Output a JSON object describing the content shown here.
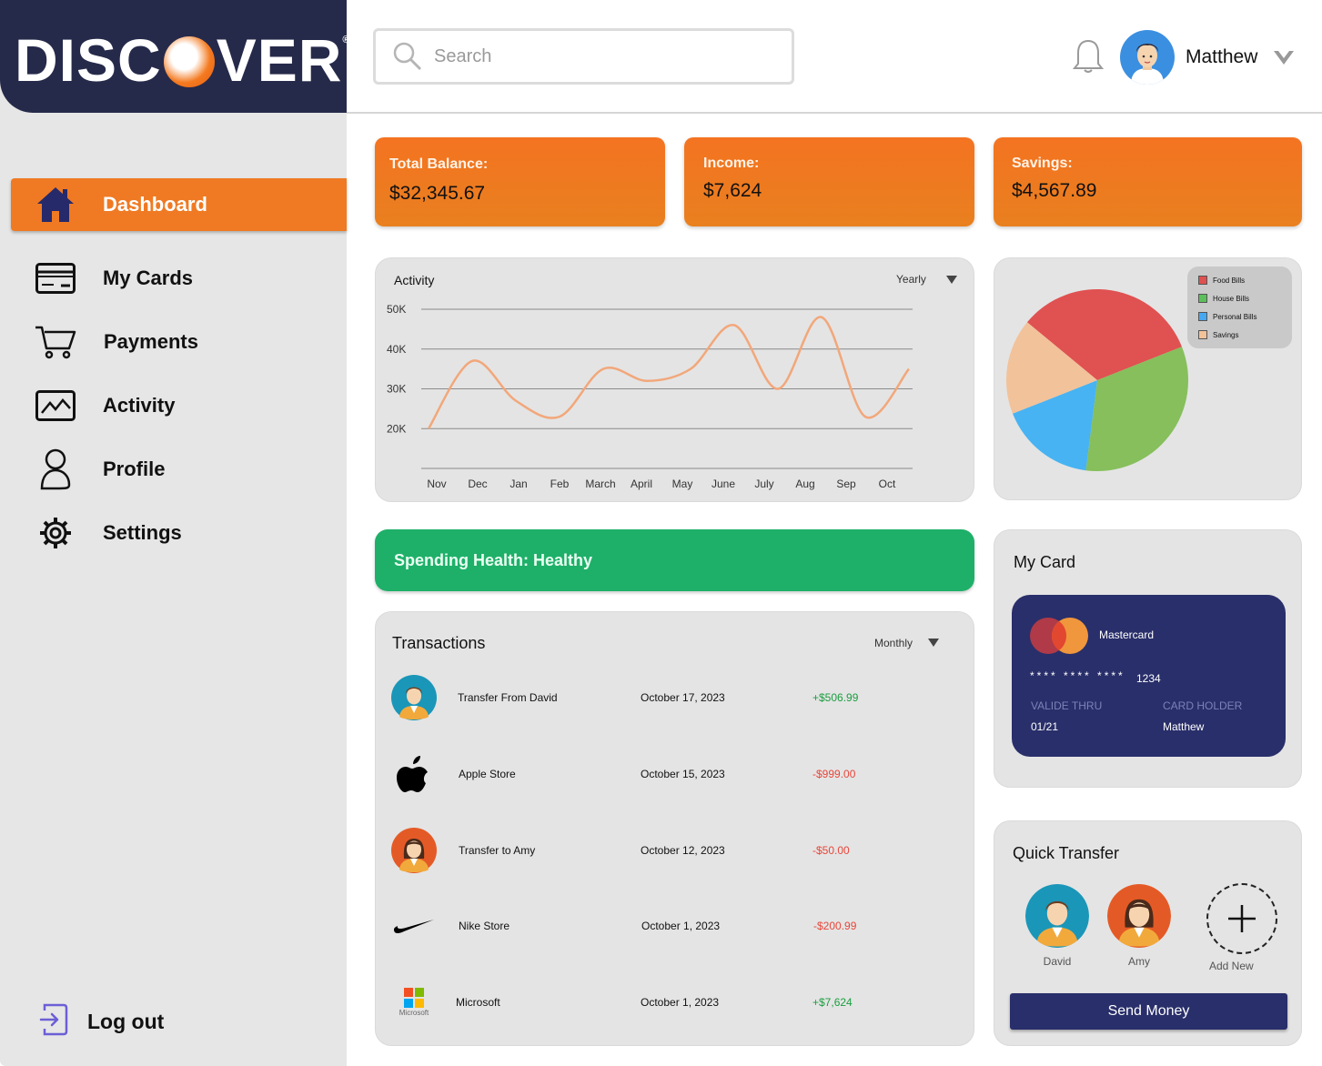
{
  "brand": {
    "logo_text_before": "DISC",
    "logo_text_after": "VER",
    "logo_mark": "®"
  },
  "sidebar": {
    "items": [
      {
        "label": "Dashboard",
        "icon": "home-icon",
        "active": true
      },
      {
        "label": "My Cards",
        "icon": "card-icon"
      },
      {
        "label": "Payments",
        "icon": "cart-icon"
      },
      {
        "label": "Activity",
        "icon": "activity-icon"
      },
      {
        "label": "Profile",
        "icon": "profile-icon"
      },
      {
        "label": "Settings",
        "icon": "gear-icon"
      }
    ],
    "logout_label": "Log out"
  },
  "header": {
    "search_placeholder": "Search",
    "user_name": "Matthew"
  },
  "stats": [
    {
      "label": "Total Balance:",
      "value": "$32,345.67"
    },
    {
      "label": "Income:",
      "value": "$7,624"
    },
    {
      "label": "Savings:",
      "value": "$4,567.89"
    }
  ],
  "activity": {
    "title": "Activity",
    "period": "Yearly"
  },
  "chart_data": [
    {
      "type": "line",
      "title": "Activity",
      "x": [
        "Nov",
        "Dec",
        "Jan",
        "Feb",
        "March",
        "April",
        "May",
        "June",
        "July",
        "Aug",
        "Sep",
        "Oct"
      ],
      "y_ticks": [
        "50K",
        "40K",
        "30K",
        "20K"
      ],
      "ylim": [
        10000,
        50000
      ],
      "series": [
        {
          "values": [
            20000,
            37000,
            27000,
            23000,
            35000,
            32000,
            35000,
            46000,
            30000,
            48000,
            23000,
            35000
          ],
          "color": "#f2a77a"
        }
      ],
      "grid": true
    },
    {
      "type": "pie",
      "legend": [
        "Food Bills",
        "House Bills",
        "Personal Bills",
        "Savings"
      ],
      "legend_position": "top-right",
      "values": [
        33,
        33,
        17,
        17
      ],
      "colors": [
        "#e05151",
        "#86bf5b",
        "#47b3f2",
        "#f2c29a"
      ]
    }
  ],
  "health": {
    "label": "Spending Health: Healthy"
  },
  "transactions": {
    "title": "Transactions",
    "period": "Monthly",
    "rows": [
      {
        "name": "Transfer From David",
        "date": "October 17, 2023",
        "amount": "+$506.99",
        "sign": "pos",
        "icon": "person-icon"
      },
      {
        "name": "Apple Store",
        "date": "October 15, 2023",
        "amount": "-$999.00",
        "sign": "neg",
        "icon": "apple-icon"
      },
      {
        "name": "Transfer to Amy",
        "date": "October 12, 2023",
        "amount": "-$50.00",
        "sign": "neg",
        "icon": "person-icon"
      },
      {
        "name": "Nike Store",
        "date": "October 1, 2023",
        "amount": "-$200.99",
        "sign": "neg",
        "icon": "nike-icon"
      },
      {
        "name": "Microsoft",
        "date": "October 1, 2023",
        "amount": "+$7,624",
        "sign": "pos",
        "icon": "microsoft-icon",
        "icon_caption": "Microsoft"
      }
    ]
  },
  "my_card": {
    "title": "My Card",
    "brand": "Mastercard",
    "masked": "**** **** ****",
    "last4": "1234",
    "valid_label": "VALIDE THRU",
    "valid_value": "01/21",
    "holder_label": "CARD HOLDER",
    "holder_value": "Matthew"
  },
  "quick_transfer": {
    "title": "Quick Transfer",
    "people": [
      {
        "name": "David"
      },
      {
        "name": "Amy"
      }
    ],
    "add_label": "Add New",
    "send_label": "Send Money"
  }
}
